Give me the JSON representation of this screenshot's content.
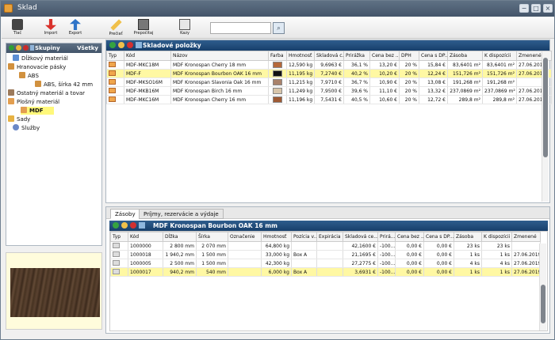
{
  "app": {
    "title": "Sklad"
  },
  "toolbar": {
    "items": [
      {
        "label": "Tlač",
        "icon": "print-icon"
      },
      {
        "label": "Import",
        "icon": "import-icon"
      },
      {
        "label": "Export",
        "icon": "export-icon"
      },
      {
        "label": "Prečiať",
        "icon": "edit-icon"
      },
      {
        "label": "Prepočítaj",
        "icon": "calculator-icon"
      },
      {
        "label": "Kazy",
        "icon": "defects-icon"
      }
    ],
    "search_placeholder": ""
  },
  "left": {
    "title": "Skupiny",
    "all": "Všetky",
    "tree": [
      {
        "label": "Dĺžkový materiál"
      },
      {
        "label": "Hranovacie pásky"
      },
      {
        "label": "ABS"
      },
      {
        "label": "ABS, šírka 42 mm"
      },
      {
        "label": "Ostatný materiál a tovar"
      },
      {
        "label": "Plošný materiál"
      },
      {
        "label": "MDF"
      },
      {
        "label": "Sady"
      },
      {
        "label": "Služby"
      }
    ]
  },
  "items_pane": {
    "title": "Skladové položky",
    "headers": [
      "Typ",
      "Kód",
      "Názov",
      "Farba",
      "Hmotnosť",
      "Skladová c...",
      "Prirážka",
      "Cena bez ...",
      "DPH",
      "Cena s DP...",
      "Zásoba",
      "K dispozícii",
      "Zmenené"
    ],
    "rows": [
      {
        "kod": "MDF-MKC18M",
        "nazov": "MDF Kronospan Cherry 18 mm",
        "farba": "#b5683a",
        "hmot": "12,590 kg",
        "skl": "9,6963 €",
        "pri": "36,1 %",
        "bez": "13,20 €",
        "dph": "20 %",
        "sdph": "15,84 €",
        "zas": "83,6401 m²",
        "kdisp": "83,6401 m²",
        "zm": "27.06.2019"
      },
      {
        "kod": "MDF-F",
        "nazov": "MDF Kronospan Bourbon OAK 16 mm",
        "farba": "#111111",
        "hmot": "11,195 kg",
        "skl": "7,2740 €",
        "pri": "40,2 %",
        "bez": "10,20 €",
        "dph": "20 %",
        "sdph": "12,24 €",
        "zas": "151,726 m²",
        "kdisp": "151,726 m²",
        "zm": "27.06.2019"
      },
      {
        "kod": "MDF-MKSO16M",
        "nazov": "MDF Kronospan Slavonia Oak 16 mm",
        "farba": "#a9826b",
        "hmot": "11,215 kg",
        "skl": "7,9710 €",
        "pri": "36,7 %",
        "bez": "10,90 €",
        "dph": "20 %",
        "sdph": "13,08 €",
        "zas": "191,268 m²",
        "kdisp": "191,268 m²",
        "zm": ""
      },
      {
        "kod": "MDF-MKB16M",
        "nazov": "MDF Kronospan Birch 16 mm",
        "farba": "#d8c5aa",
        "hmot": "11,249 kg",
        "skl": "7,9500 €",
        "pri": "39,6 %",
        "bez": "11,10 €",
        "dph": "20 %",
        "sdph": "13,32 €",
        "zas": "237,0869 m²",
        "kdisp": "237,0869 m²",
        "zm": "27.06.2019"
      },
      {
        "kod": "MDF-MKC16M",
        "nazov": "MDF Kronospan Cherry 16 mm",
        "farba": "#9f5a34",
        "hmot": "11,196 kg",
        "skl": "7,5431 €",
        "pri": "40,5 %",
        "bez": "10,60 €",
        "dph": "20 %",
        "sdph": "12,72 €",
        "zas": "289,8 m²",
        "kdisp": "289,8 m²",
        "zm": "27.06.2019"
      }
    ]
  },
  "tabs": [
    {
      "label": "Zásoby"
    },
    {
      "label": "Príjmy, rezervácie a výdaje"
    }
  ],
  "stock_pane": {
    "title": "MDF Kronospan Bourbon OAK 16 mm",
    "headers": [
      "Typ",
      "Kód",
      "Dĺžka",
      "Šírka",
      "Označenie",
      "Hmotnosť",
      "Pozícia v...",
      "Expirácia",
      "Skladová ce...",
      "Prirá...",
      "Cena bez ...",
      "Cena s DP...",
      "Zásoba",
      "K dispozícii",
      "Zmenené"
    ],
    "rows": [
      {
        "kod": "1000000",
        "dlzka": "2 800 mm",
        "sirka": "2 070 mm",
        "ozn": "",
        "hmot": "64,800 kg",
        "poz": "",
        "exp": "",
        "skl": "42,1600 €",
        "pri": "-100...",
        "bez": "0,00 €",
        "sdph": "0,00 €",
        "zas": "23 ks",
        "kd": "23 ks",
        "zm": ""
      },
      {
        "kod": "1000018",
        "dlzka": "1 940,2 mm",
        "sirka": "1 500 mm",
        "ozn": "",
        "hmot": "33,000 kg",
        "poz": "Box A",
        "exp": "",
        "skl": "21,1695 €",
        "pri": "-100...",
        "bez": "0,00 €",
        "sdph": "0,00 €",
        "zas": "1 ks",
        "kd": "1 ks",
        "zm": "27.06.2019"
      },
      {
        "kod": "1000005",
        "dlzka": "2 500 mm",
        "sirka": "1 500 mm",
        "ozn": "",
        "hmot": "42,300 kg",
        "poz": "",
        "exp": "",
        "skl": "27,2775 €",
        "pri": "-100...",
        "bez": "0,00 €",
        "sdph": "0,00 €",
        "zas": "4 ks",
        "kd": "4 ks",
        "zm": "27.06.2019"
      },
      {
        "kod": "1000017",
        "dlzka": "940,2 mm",
        "sirka": "540 mm",
        "ozn": "",
        "hmot": "6,000 kg",
        "poz": "Box A",
        "exp": "",
        "skl": "3,6931 €",
        "pri": "-100...",
        "bez": "0,00 €",
        "sdph": "0,00 €",
        "zas": "1 ks",
        "kd": "1 ks",
        "zm": "27.06.2019"
      }
    ]
  }
}
